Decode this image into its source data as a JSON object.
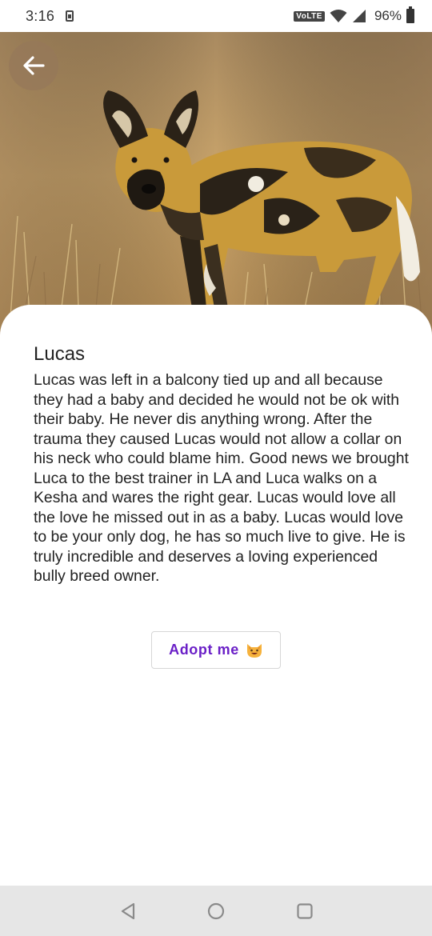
{
  "status_bar": {
    "time": "3:16",
    "network_badge": "VoLTE",
    "battery_percent": "96%",
    "icons": [
      "sim-card-icon",
      "wifi-icon",
      "cell-signal-icon",
      "battery-icon"
    ]
  },
  "header": {
    "back_icon": "arrow-left-icon"
  },
  "pet": {
    "name": "Lucas",
    "description": "Lucas was left in a balcony tied up and all because they had a baby and decided he would not be ok with their baby. He never dis anything wrong. After the trauma they caused Lucas would not allow a collar on his neck who could blame him. Good news we brought Luca to the best trainer in LA and Luca walks on a Kesha and wares the right gear. Lucas would love all the love he missed out in as a baby. Lucas would love to be your only dog, he has so much live to give. He is truly incredible and deserves a loving experienced bully breed owner."
  },
  "actions": {
    "adopt_label": "Adopt me",
    "adopt_icon": "smiling-cat-emoji-icon"
  },
  "nav": {
    "icons": [
      "nav-back-icon",
      "nav-home-icon",
      "nav-recents-icon"
    ]
  },
  "colors": {
    "accent": "#6a1fc7",
    "nav_background": "#e6e6e6",
    "card_background": "#ffffff"
  }
}
